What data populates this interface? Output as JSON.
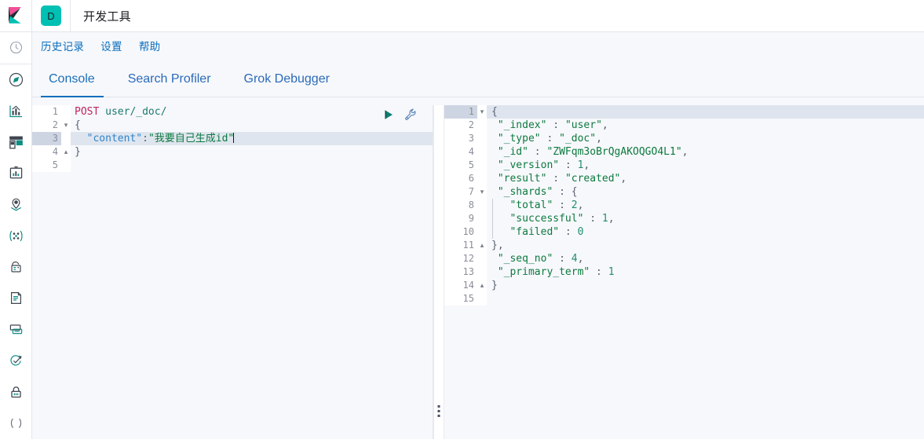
{
  "window": {
    "app_badge_letter": "D",
    "app_title": "开发工具",
    "logo_icon": "kibana-logo-icon"
  },
  "menu": {
    "items": [
      {
        "label": "历史记录",
        "name": "menu-history"
      },
      {
        "label": "设置",
        "name": "menu-settings"
      },
      {
        "label": "帮助",
        "name": "menu-help"
      }
    ]
  },
  "tabs": {
    "active": "Console",
    "items": [
      {
        "label": "Console",
        "active": true
      },
      {
        "label": "Search Profiler",
        "active": false
      },
      {
        "label": "Grok Debugger",
        "active": false
      }
    ]
  },
  "sidebar": {
    "items": [
      {
        "name": "sidebar-item-recent",
        "icon": "clock-icon"
      },
      {
        "name": "sidebar-item-discover",
        "icon": "compass-icon"
      },
      {
        "name": "sidebar-item-visualize",
        "icon": "bar-chart-icon"
      },
      {
        "name": "sidebar-item-dashboard",
        "icon": "dashboard-icon"
      },
      {
        "name": "sidebar-item-canvas",
        "icon": "presentation-icon"
      },
      {
        "name": "sidebar-item-maps",
        "icon": "map-marker-icon"
      },
      {
        "name": "sidebar-item-ml",
        "icon": "machine-learning-icon"
      },
      {
        "name": "sidebar-item-infrastructure",
        "icon": "infrastructure-icon"
      },
      {
        "name": "sidebar-item-logs",
        "icon": "logs-document-icon"
      },
      {
        "name": "sidebar-item-apm",
        "icon": "apm-monitor-icon"
      },
      {
        "name": "sidebar-item-uptime",
        "icon": "uptime-check-icon"
      },
      {
        "name": "sidebar-item-siem",
        "icon": "lock-security-icon"
      },
      {
        "name": "sidebar-item-devtools",
        "icon": "wrench-devtools-icon"
      }
    ]
  },
  "editor": {
    "actions": {
      "play": {
        "name": "send-request-play-icon",
        "color": "#0d7f74"
      },
      "wrench": {
        "name": "request-options-wrench-icon",
        "color": "#4a7fb5"
      }
    },
    "highlighted_line": 3,
    "cursor_line": 3,
    "lines": [
      {
        "num": "1",
        "fold": "",
        "method": "POST",
        "url": " user/_doc/"
      },
      {
        "num": "2",
        "fold": "▾",
        "text": "{"
      },
      {
        "num": "3",
        "fold": "",
        "key": "\"content\"",
        "colon": ":",
        "value": "\"我要自己生成id\""
      },
      {
        "num": "4",
        "fold": "▴",
        "text": "}"
      },
      {
        "num": "5",
        "fold": "",
        "text": ""
      }
    ]
  },
  "response": {
    "highlighted_line": 1,
    "lines": [
      {
        "num": "1",
        "fold": "▾",
        "text": "{"
      },
      {
        "num": "2",
        "fold": "",
        "key": "\"_index\"",
        "sep": " : ",
        "value": "\"user\"",
        "tail": ","
      },
      {
        "num": "3",
        "fold": "",
        "key": "\"_type\"",
        "sep": " : ",
        "value": "\"_doc\"",
        "tail": ","
      },
      {
        "num": "4",
        "fold": "",
        "key": "\"_id\"",
        "sep": " : ",
        "value": "\"ZWFqm3oBrQgAKOQGO4L1\"",
        "tail": ","
      },
      {
        "num": "5",
        "fold": "",
        "key": "\"_version\"",
        "sep": " : ",
        "value": "1",
        "tail": ","
      },
      {
        "num": "6",
        "fold": "",
        "key": "\"result\"",
        "sep": " : ",
        "value": "\"created\"",
        "tail": ","
      },
      {
        "num": "7",
        "fold": "▾",
        "key": "\"_shards\"",
        "sep": " : ",
        "value": "{",
        "tail": ""
      },
      {
        "num": "8",
        "fold": "",
        "key": "  \"total\"",
        "sep": " : ",
        "value": "2",
        "tail": ",",
        "indent": true
      },
      {
        "num": "9",
        "fold": "",
        "key": "  \"successful\"",
        "sep": " : ",
        "value": "1",
        "tail": ",",
        "indent": true
      },
      {
        "num": "10",
        "fold": "",
        "key": "  \"failed\"",
        "sep": " : ",
        "value": "0",
        "tail": "",
        "indent": true
      },
      {
        "num": "11",
        "fold": "▴",
        "text": "},"
      },
      {
        "num": "12",
        "fold": "",
        "key": "\"_seq_no\"",
        "sep": " : ",
        "value": "4",
        "tail": ","
      },
      {
        "num": "13",
        "fold": "",
        "key": "\"_primary_term\"",
        "sep": " : ",
        "value": "1",
        "tail": ""
      },
      {
        "num": "14",
        "fold": "▴",
        "text": "}"
      },
      {
        "num": "15",
        "fold": "",
        "text": ""
      }
    ]
  },
  "colors": {
    "accent": "#0a6ebd",
    "brand_teal": "#00bfb3",
    "editor_bg": "#f7f8fc",
    "highlight_line": "#dfe5ef",
    "string_green": "#0c7a3e",
    "key_blue": "#2f84c9",
    "method_pink": "#c0255f"
  }
}
